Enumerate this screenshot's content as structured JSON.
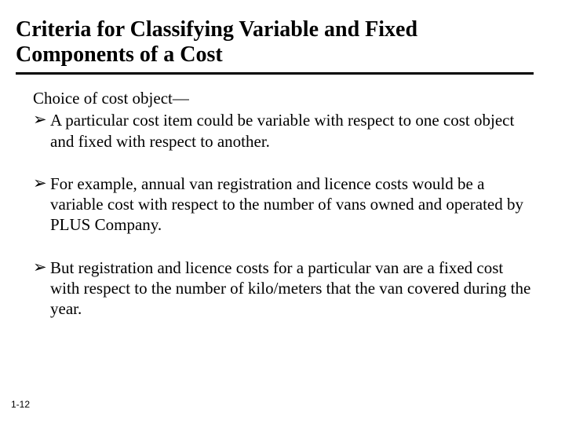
{
  "title": "Criteria for Classifying Variable and Fixed Components of a Cost",
  "lead": "Choice of cost object—",
  "bullets": [
    "A particular cost item could be variable with respect to one cost object and fixed with respect to another.",
    "For example, annual van registration and licence costs would be a variable cost with respect to the number of vans owned and operated by PLUS Company.",
    "But registration and licence costs for a particular van are a fixed cost with respect to the number of kilo/meters that the van covered during the year."
  ],
  "marker": "➢",
  "page_number": "1-12"
}
